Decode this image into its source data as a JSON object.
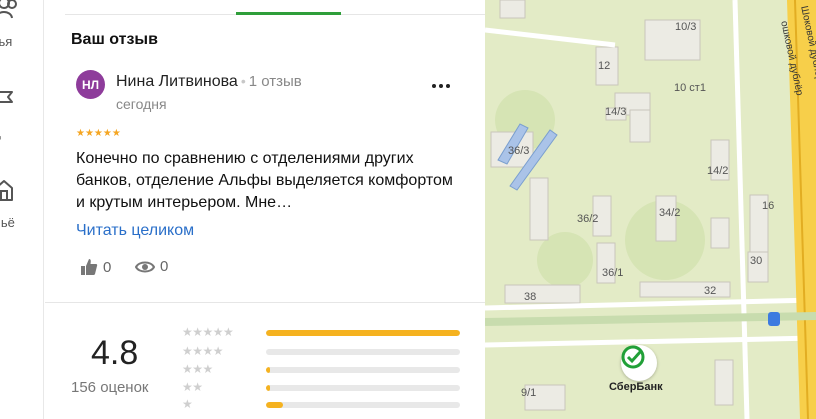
{
  "nav": {
    "items": [
      {
        "label": "узья",
        "icon": "friends-icon"
      },
      {
        "label": "ид",
        "icon": "guide-icon"
      },
      {
        "label": "ильё",
        "icon": "housing-icon"
      }
    ]
  },
  "review_panel": {
    "section_title": "Ваш отзыв",
    "avatar_initials": "НЛ",
    "avatar_color": "#8e3c9b",
    "author_name": "Нина Литвинова",
    "separator": "•",
    "author_review_count": "1 отзыв",
    "date": "сегодня",
    "stars": "★★★★★",
    "text": "Конечно по сравнению с отделениями других банков, отделение Альфы выделяется комфортом и крутым интерьером. Мне…",
    "read_more": "Читать целиком",
    "likes": "0",
    "views": "0"
  },
  "rating": {
    "value": "4.8",
    "count": "156 оценок",
    "distribution": [
      {
        "stars": "★★★★★",
        "fill": 1.0
      },
      {
        "stars": "★★★★",
        "fill": 0.0
      },
      {
        "stars": "★★★",
        "fill": 0.02
      },
      {
        "stars": "★★",
        "fill": 0.02
      },
      {
        "stars": "★",
        "fill": 0.09
      }
    ],
    "bar_color": "#f5b21f"
  },
  "map": {
    "labels": [
      "10/3",
      "12",
      "10 ст1",
      "14/3",
      "36/3",
      "14/2",
      "36/2",
      "34/2",
      "16",
      "36/1",
      "30",
      "38",
      "32",
      "9/1"
    ],
    "road_label": "ошковой дублёр",
    "road_label_2": "Шоковой дублёр",
    "poi_name": "СберБанк",
    "accent_green": "#2f9e3a",
    "link_color": "#2a6fc9"
  }
}
